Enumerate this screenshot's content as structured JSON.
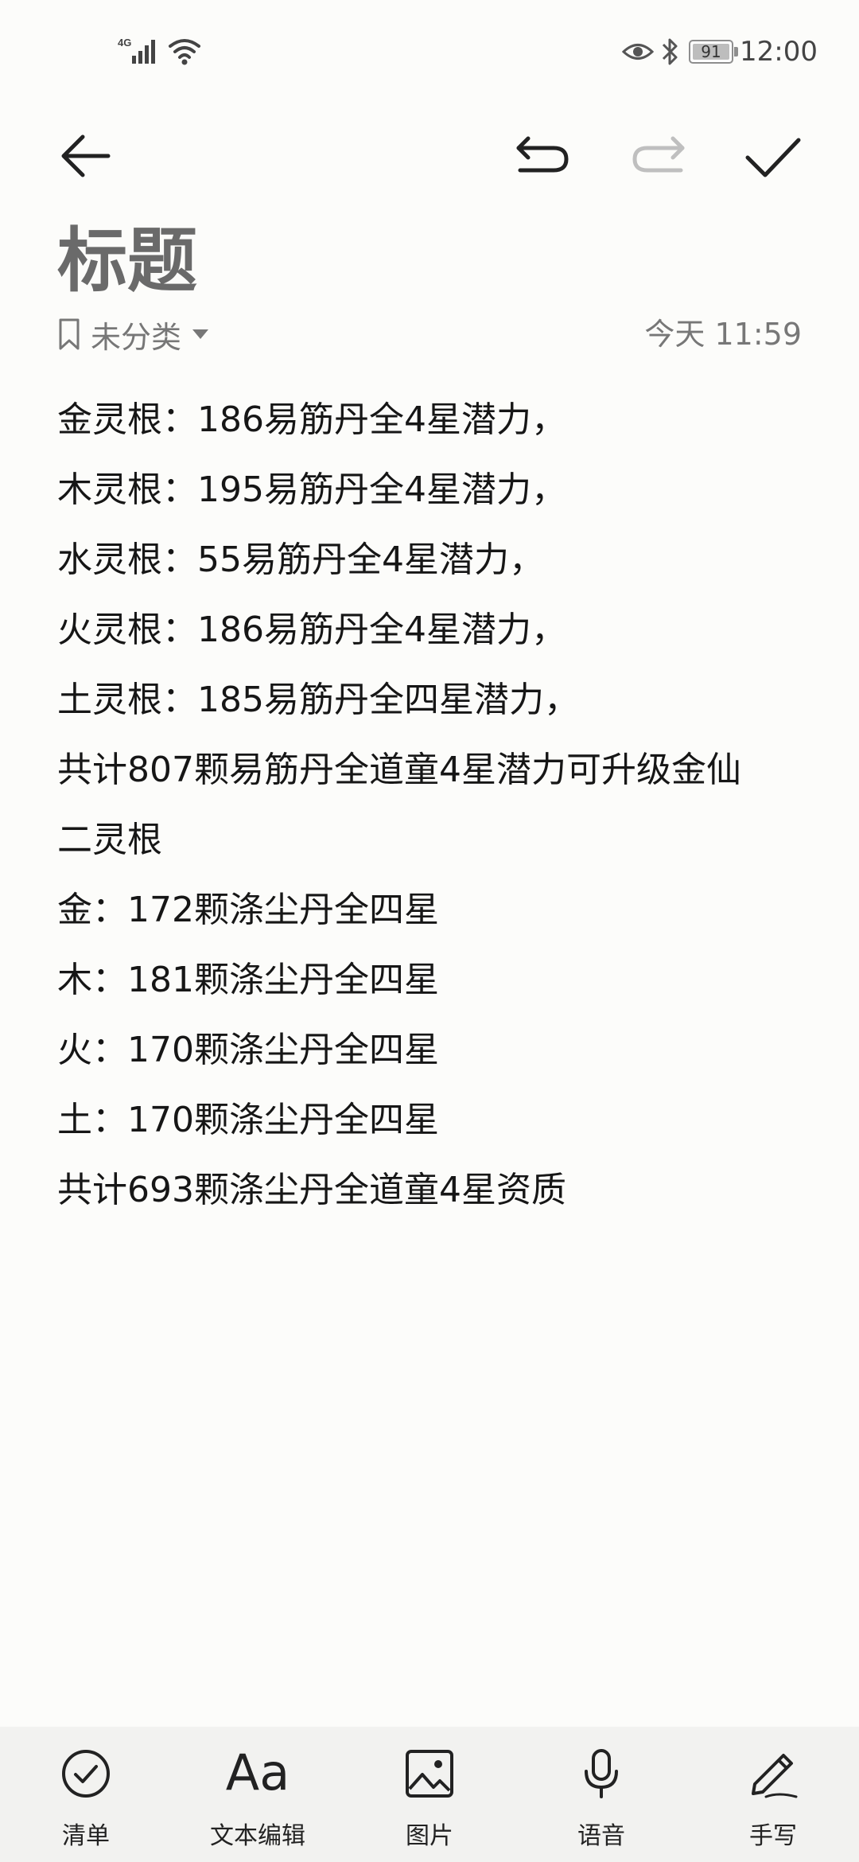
{
  "status_bar": {
    "network": "4G",
    "battery_level": "91",
    "time": "12:00",
    "icons": [
      "signal-icon",
      "wifi-icon",
      "eye-icon",
      "bluetooth-icon",
      "battery-icon"
    ]
  },
  "toolbar": {
    "icons": [
      "back-arrow-icon",
      "undo-icon",
      "redo-icon",
      "check-icon"
    ]
  },
  "note": {
    "title": "标题",
    "category": "未分类",
    "timestamp": "今天 11:59",
    "lines": [
      "金灵根：186易筋丹全4星潜力，",
      "木灵根：195易筋丹全4星潜力，",
      "水灵根：55易筋丹全4星潜力，",
      "火灵根：186易筋丹全4星潜力，",
      "土灵根：185易筋丹全四星潜力，",
      "共计807颗易筋丹全道童4星潜力可升级金仙",
      "二灵根",
      "金：172颗涤尘丹全四星",
      "木：181颗涤尘丹全四星",
      "火：170颗涤尘丹全四星",
      "土：170颗涤尘丹全四星",
      "共计693颗涤尘丹全道童4星资质"
    ]
  },
  "bottom_bar": {
    "items": [
      {
        "label": "清单",
        "icon": "checklist-icon"
      },
      {
        "label": "文本编辑",
        "icon_text": "Aa"
      },
      {
        "label": "图片",
        "icon": "image-icon"
      },
      {
        "label": "语音",
        "icon": "microphone-icon"
      },
      {
        "label": "手写",
        "icon": "pen-icon"
      }
    ]
  },
  "colors": {
    "background": "#fcfcfa",
    "title": "#6a6a6a",
    "meta": "#777777",
    "text": "#161616",
    "disabled": "#bfbfbf",
    "bottom_bar": "#f2f2f0"
  }
}
